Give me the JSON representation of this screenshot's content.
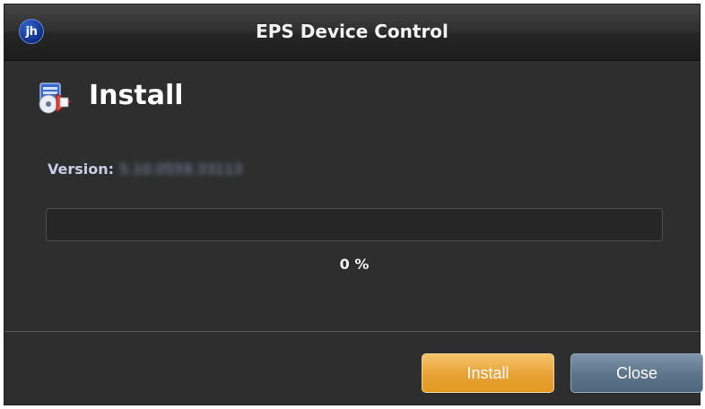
{
  "window": {
    "title": "EPS Device Control",
    "logo_text": "jh"
  },
  "content": {
    "heading": "Install",
    "heading_icon": "install-disc-icon",
    "version_label": "Version:",
    "version_value": "5.10.0559.33113"
  },
  "progress": {
    "fraction": 0.0,
    "label": "0 %"
  },
  "buttons": {
    "install_label": "Install",
    "close_label": "Close"
  },
  "colors": {
    "window_bg": "#2e2e2e",
    "install_button": "#e8a234",
    "close_button": "#5c7389",
    "version_label": "#c9cce6"
  }
}
